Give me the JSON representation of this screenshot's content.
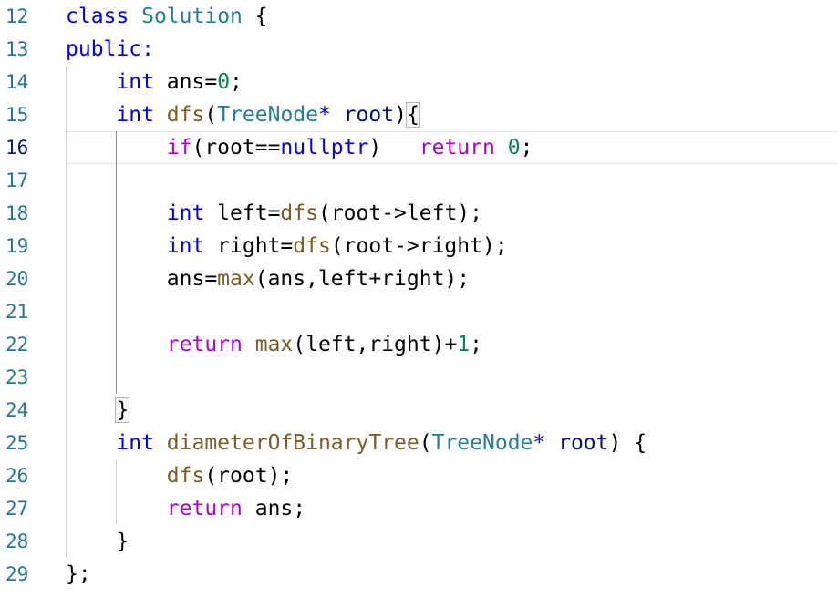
{
  "editor": {
    "current_line": "16",
    "lines": [
      {
        "num": "12",
        "tokens": [
          {
            "t": "class",
            "c": "#0000ff"
          },
          {
            "t": " ",
            "c": "#000000"
          },
          {
            "t": "Solution",
            "c": "#267f99"
          },
          {
            "t": " {",
            "c": "#000000"
          }
        ]
      },
      {
        "num": "13",
        "tokens": [
          {
            "t": "public:",
            "c": "#0000ff"
          }
        ]
      },
      {
        "num": "14",
        "tokens": [
          {
            "t": "    ",
            "c": "#000000"
          },
          {
            "t": "int",
            "c": "#0000ff"
          },
          {
            "t": " ans=",
            "c": "#000000"
          },
          {
            "t": "0",
            "c": "#098658"
          },
          {
            "t": ";",
            "c": "#000000"
          }
        ]
      },
      {
        "num": "15",
        "tokens": [
          {
            "t": "    ",
            "c": "#000000"
          },
          {
            "t": "int",
            "c": "#0000ff"
          },
          {
            "t": " ",
            "c": "#000000"
          },
          {
            "t": "dfs",
            "c": "#795e26"
          },
          {
            "t": "(",
            "c": "#000000"
          },
          {
            "t": "TreeNode",
            "c": "#267f99"
          },
          {
            "t": "*",
            "c": "#0000ff"
          },
          {
            "t": " ",
            "c": "#000000"
          },
          {
            "t": "root",
            "c": "#001080"
          },
          {
            "t": ")",
            "c": "#000000"
          },
          {
            "t": "{",
            "c": "#000000",
            "bm": true
          }
        ]
      },
      {
        "num": "16",
        "tokens": [
          {
            "t": "        ",
            "c": "#000000"
          },
          {
            "t": "if",
            "c": "#af00db"
          },
          {
            "t": "(root==",
            "c": "#000000"
          },
          {
            "t": "nullptr",
            "c": "#0000ff"
          },
          {
            "t": ")   ",
            "c": "#000000"
          },
          {
            "t": "return",
            "c": "#af00db"
          },
          {
            "t": " ",
            "c": "#000000"
          },
          {
            "t": "0",
            "c": "#098658"
          },
          {
            "t": ";",
            "c": "#000000"
          }
        ]
      },
      {
        "num": "17",
        "tokens": []
      },
      {
        "num": "18",
        "tokens": [
          {
            "t": "        ",
            "c": "#000000"
          },
          {
            "t": "int",
            "c": "#0000ff"
          },
          {
            "t": " left=",
            "c": "#000000"
          },
          {
            "t": "dfs",
            "c": "#795e26"
          },
          {
            "t": "(root->left);",
            "c": "#000000"
          }
        ]
      },
      {
        "num": "19",
        "tokens": [
          {
            "t": "        ",
            "c": "#000000"
          },
          {
            "t": "int",
            "c": "#0000ff"
          },
          {
            "t": " right=",
            "c": "#000000"
          },
          {
            "t": "dfs",
            "c": "#795e26"
          },
          {
            "t": "(root->right);",
            "c": "#000000"
          }
        ]
      },
      {
        "num": "20",
        "tokens": [
          {
            "t": "        ans=",
            "c": "#000000"
          },
          {
            "t": "max",
            "c": "#795e26"
          },
          {
            "t": "(ans,left+right);",
            "c": "#000000"
          }
        ]
      },
      {
        "num": "21",
        "tokens": []
      },
      {
        "num": "22",
        "tokens": [
          {
            "t": "        ",
            "c": "#000000"
          },
          {
            "t": "return",
            "c": "#af00db"
          },
          {
            "t": " ",
            "c": "#000000"
          },
          {
            "t": "max",
            "c": "#795e26"
          },
          {
            "t": "(left,right)+",
            "c": "#000000"
          },
          {
            "t": "1",
            "c": "#098658"
          },
          {
            "t": ";",
            "c": "#000000"
          }
        ]
      },
      {
        "num": "23",
        "tokens": []
      },
      {
        "num": "24",
        "tokens": [
          {
            "t": "    ",
            "c": "#000000"
          },
          {
            "t": "}",
            "c": "#000000",
            "bm": true
          }
        ]
      },
      {
        "num": "25",
        "tokens": [
          {
            "t": "    ",
            "c": "#000000"
          },
          {
            "t": "int",
            "c": "#0000ff"
          },
          {
            "t": " ",
            "c": "#000000"
          },
          {
            "t": "diameterOfBinaryTree",
            "c": "#795e26"
          },
          {
            "t": "(",
            "c": "#000000"
          },
          {
            "t": "TreeNode",
            "c": "#267f99"
          },
          {
            "t": "*",
            "c": "#0000ff"
          },
          {
            "t": " ",
            "c": "#000000"
          },
          {
            "t": "root",
            "c": "#001080"
          },
          {
            "t": ") {",
            "c": "#000000"
          }
        ]
      },
      {
        "num": "26",
        "tokens": [
          {
            "t": "        ",
            "c": "#000000"
          },
          {
            "t": "dfs",
            "c": "#795e26"
          },
          {
            "t": "(root);",
            "c": "#000000"
          }
        ]
      },
      {
        "num": "27",
        "tokens": [
          {
            "t": "        ",
            "c": "#000000"
          },
          {
            "t": "return",
            "c": "#af00db"
          },
          {
            "t": " ans;",
            "c": "#000000"
          }
        ]
      },
      {
        "num": "28",
        "tokens": [
          {
            "t": "    }",
            "c": "#000000"
          }
        ]
      },
      {
        "num": "29",
        "tokens": [
          {
            "t": "};",
            "c": "#000000"
          }
        ]
      }
    ]
  }
}
